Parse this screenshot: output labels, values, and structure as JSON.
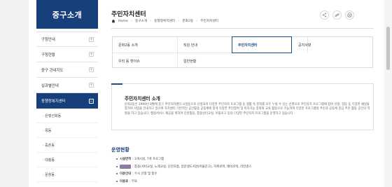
{
  "sidebar": {
    "heading": "중구소개",
    "items": [
      {
        "label": "구청안내"
      },
      {
        "label": "구청현황"
      },
      {
        "label": "중구 관내지도"
      },
      {
        "label": "실과별안내"
      },
      {
        "label": "동행정복지센터",
        "active": true
      }
    ],
    "sub_items": [
      "· 은행선화동",
      "· 목동",
      "· 중촌동",
      "· 대흥동",
      "· 문창동"
    ],
    "plus_symbol": "+",
    "minus_symbol": "−"
  },
  "header": {
    "title": "주민자치센터",
    "breadcrumb": [
      "Home",
      "중구소개",
      "동행정복지센터",
      "문화2동",
      "주민자치센터"
    ],
    "tools": [
      "share-icon",
      "link-icon",
      "print-icon"
    ]
  },
  "tabs": [
    {
      "label": "문화2동 소개"
    },
    {
      "label": "직원 안내"
    },
    {
      "label": "주민자치센터",
      "active": true
    },
    {
      "label": "공지사항"
    },
    {
      "label": "우리 동 핫이슈"
    },
    {
      "label": "일반현황"
    }
  ],
  "intro": {
    "title": "주민자치센터 소개",
    "body": "문화2동은 1999년 8월에 중구 주민자치센터 시범동으로 선정되어 다양한 주민자치 프로그램 등 생활 속 문화를 모두 누릴 수 있는 운영으로 주민자치 프로그램에 참여 신청, 엄동 등 다양한 채널을 통하여 사업을 안내하고 있으며 자치센터 기본적인 공간활용 공동체에 맞게 다양한 주민참여 및 복지기능 강화와 교육 활동으로 기능하며 다양한 프로그램의 추진과 공동체 중심 주민 활동 공간의 역할을 하고 있습니다. 행정서비스 제공을 위하여 단란활동, 통합선터교실, 아울로고 등의 다양한 주민자치 프로그램을 운영하고 있습니다."
  },
  "operations": {
    "title": "운영현황",
    "rows": [
      {
        "label": "시설면적",
        "value": ": 3개시설, 7개 프로그램"
      },
      {
        "label": "프로그램",
        "value": ": 통용(서비교실, 노래교실, 단전호흡, 일문생도서관(어울문고), 하위로박, 메이로빅, 라인댄스"
      },
      {
        "label": "이용안내",
        "value": ": 수시 신청 및 접수"
      },
      {
        "label": "이용료",
        "value": ": 무료"
      }
    ]
  },
  "colors": {
    "primary": "#173f7c",
    "accent": "#1e4a8c",
    "highlight": "#8f7aa6"
  }
}
